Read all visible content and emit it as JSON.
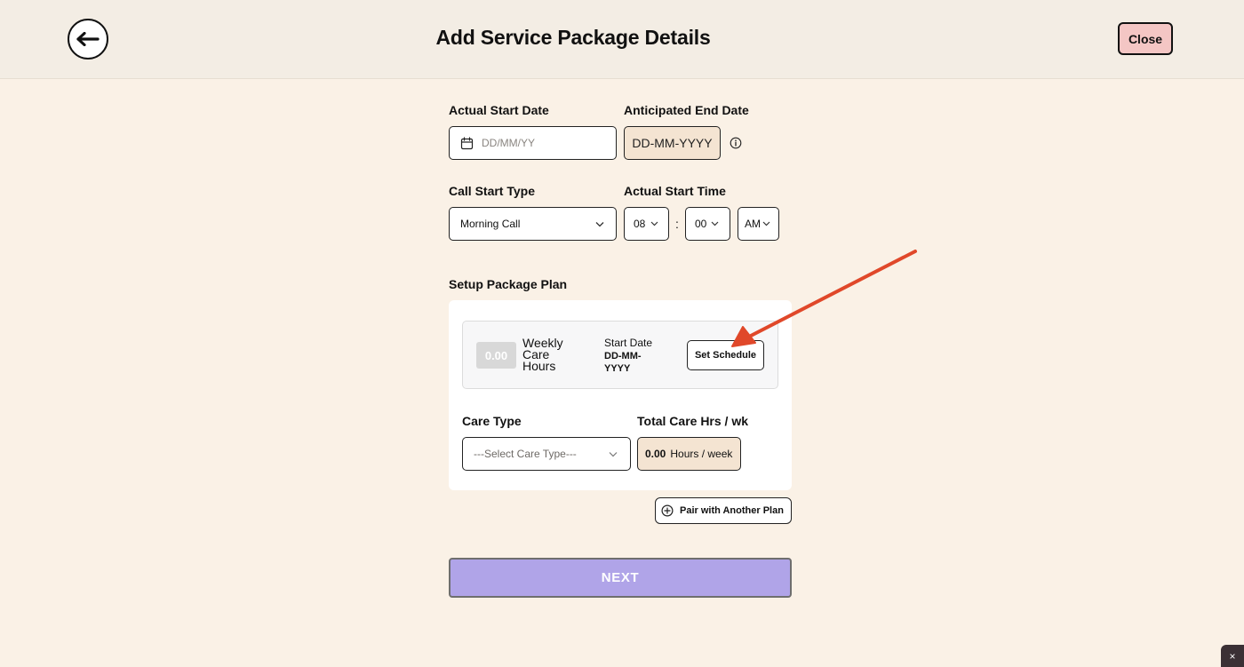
{
  "header": {
    "title": "Add Service Package Details",
    "close_label": "Close"
  },
  "form": {
    "actual_start_date": {
      "label": "Actual Start Date",
      "placeholder": "DD/MM/YY"
    },
    "anticipated_end_date": {
      "label": "Anticipated End Date",
      "value": "DD-MM-YYYY"
    },
    "call_start_type": {
      "label": "Call Start Type",
      "value": "Morning Call"
    },
    "actual_start_time": {
      "label": "Actual Start Time",
      "hour": "08",
      "separator": ":",
      "minute": "00",
      "period": "AM"
    }
  },
  "package_plan": {
    "label": "Setup Package Plan",
    "hours_value": "0.00",
    "hours_label": "Weekly Care Hours",
    "start_date_label": "Start Date",
    "start_date_value": "DD-MM-YYYY",
    "set_schedule_label": "Set Schedule",
    "care_type": {
      "label": "Care Type",
      "placeholder": "---Select Care Type---"
    },
    "total_care": {
      "label": "Total Care Hrs / wk",
      "value": "0.00",
      "unit": "Hours / week"
    }
  },
  "pair_button_label": "Pair with Another Plan",
  "next_button_label": "NEXT",
  "corner_widget_label": "×",
  "colors": {
    "page_bg": "#faf1e6",
    "header_bg": "#f3ede4",
    "close_bg": "#f4c6c4",
    "next_bg": "#b0a4e8",
    "annotation_arrow": "#e0482a"
  }
}
